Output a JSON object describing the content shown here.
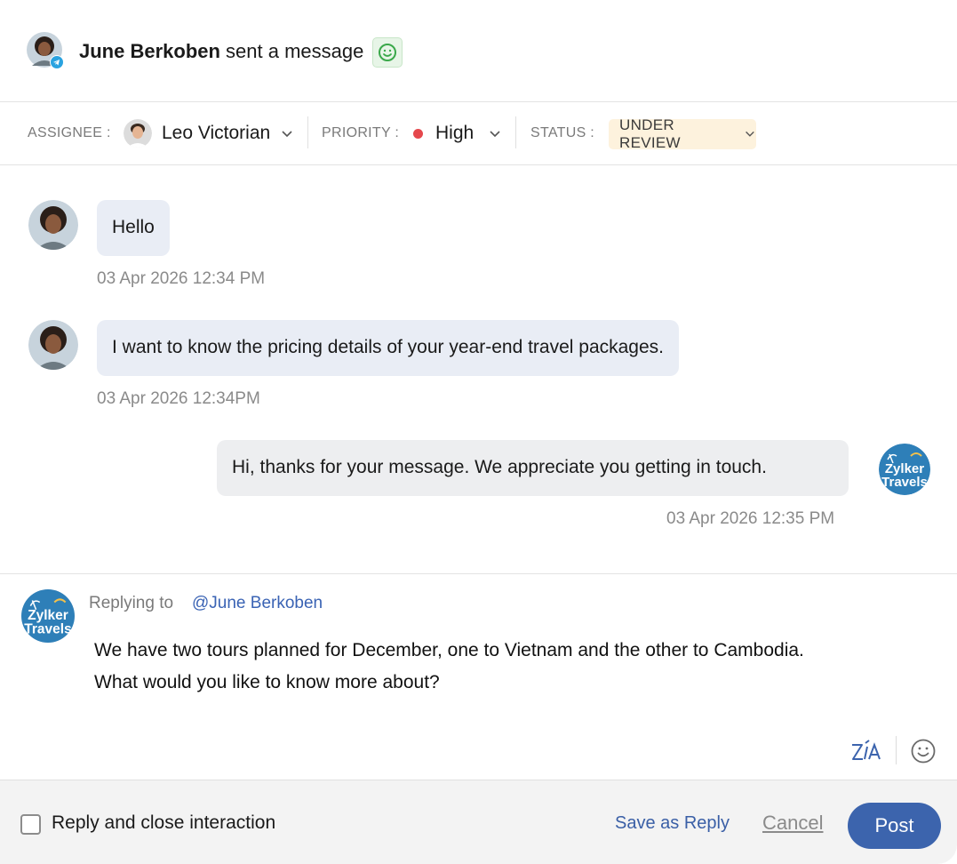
{
  "header": {
    "sender_name": "June Berkoben",
    "action_text": " sent a message",
    "avatar_icon": "woman-avatar",
    "channel_icon": "telegram-icon",
    "sentiment_icon": "smile-icon",
    "sentiment_color": "#3aa84a"
  },
  "properties": {
    "assignee_label": "ASSIGNEE :",
    "assignee_value": "Leo Victorian",
    "priority_label": "PRIORITY :",
    "priority_value": "High",
    "priority_color": "#e5484d",
    "status_label": "STATUS :",
    "status_value": "UNDER REVIEW"
  },
  "messages": [
    {
      "text": "Hello",
      "timestamp": "03 Apr 2026 12:34 PM",
      "direction": "incoming"
    },
    {
      "text": "I want to know the pricing details of your year-end travel packages.",
      "timestamp": "03 Apr 2026 12:34PM",
      "direction": "incoming"
    },
    {
      "text": "Hi, thanks for your message. We appreciate you getting in touch.",
      "timestamp": "03 Apr 2026 12:35 PM",
      "direction": "outgoing"
    }
  ],
  "brand": {
    "logo_line1": "Zylker",
    "logo_line2": "Travels",
    "logo_color": "#2e7fb8"
  },
  "reply": {
    "replying_to_label": "Replying to",
    "mention": "@June Berkoben",
    "line1": "We have two tours planned for December, one to Vietnam and the other to Cambodia.",
    "line2": "What would you like to know more about?"
  },
  "footer": {
    "checkbox_label": "Reply and close interaction",
    "checkbox_checked": false,
    "save_as_reply_label": "Save as Reply",
    "cancel_label": "Cancel",
    "post_label": "Post",
    "accent_color": "#3c64ad"
  }
}
